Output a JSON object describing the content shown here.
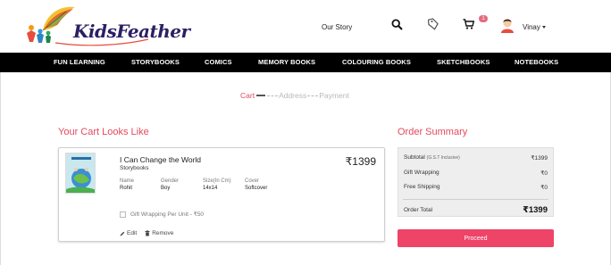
{
  "brand": {
    "logo_text": "KidsFeather"
  },
  "header": {
    "nav_story": "Our Story",
    "cart_count": "1",
    "user_name": "Vinay"
  },
  "categories": [
    "FUN LEARNING",
    "STORYBOOKS",
    "COMICS",
    "MEMORY BOOKS",
    "COLOURING BOOKS",
    "SKETCHBOOKS",
    "NOTEBOOKS"
  ],
  "steps": {
    "cart": "Cart",
    "address": "Address",
    "payment": "Payment"
  },
  "cart": {
    "title": "Your Cart Looks Like",
    "item": {
      "title": "I Can Change the World",
      "category": "Storybooks",
      "price": "₹1399",
      "attributes": [
        {
          "label": "Name",
          "value": "Rohit"
        },
        {
          "label": "Gender",
          "value": "Boy"
        },
        {
          "label": "Size(In Cm)",
          "value": "14x14"
        },
        {
          "label": "Cover",
          "value": "Softcover"
        }
      ],
      "gift_wrap_label": "Gift Wrapping Per Unit - ₹50",
      "edit_label": "Edit",
      "remove_label": "Remove"
    }
  },
  "summary": {
    "title": "Order Summary",
    "subtotal_label": "Subtotal",
    "subtotal_note": "(G.S.T Inclusive)",
    "subtotal_value": "₹1399",
    "gift_label": "Gift Wrapping",
    "gift_value": "₹0",
    "shipping_label": "Free Shipping",
    "shipping_value": "₹0",
    "total_label": "Order Total",
    "total_value": "₹1399",
    "proceed_label": "Proceed"
  },
  "colors": {
    "accent": "#e5485d",
    "button": "#ee4467",
    "nav_bg": "#000000",
    "summary_bg": "#eeeeee"
  },
  "icons": [
    "feather-logo",
    "search-icon",
    "tag-icon",
    "cart-icon",
    "avatar-icon",
    "pencil-icon",
    "trash-icon"
  ]
}
